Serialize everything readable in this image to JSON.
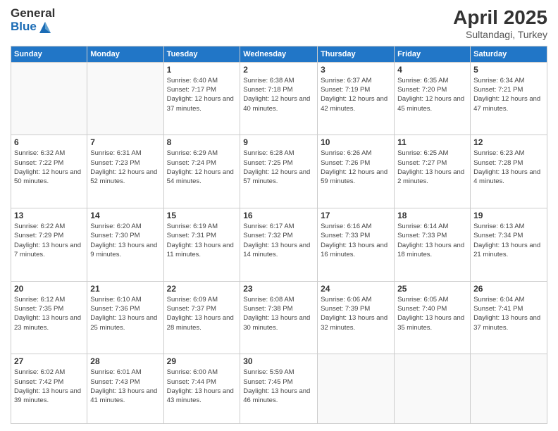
{
  "logo": {
    "general": "General",
    "blue": "Blue"
  },
  "title": "April 2025",
  "location": "Sultandagi, Turkey",
  "days_of_week": [
    "Sunday",
    "Monday",
    "Tuesday",
    "Wednesday",
    "Thursday",
    "Friday",
    "Saturday"
  ],
  "weeks": [
    [
      {
        "day": "",
        "info": ""
      },
      {
        "day": "",
        "info": ""
      },
      {
        "day": "1",
        "info": "Sunrise: 6:40 AM\nSunset: 7:17 PM\nDaylight: 12 hours and 37 minutes."
      },
      {
        "day": "2",
        "info": "Sunrise: 6:38 AM\nSunset: 7:18 PM\nDaylight: 12 hours and 40 minutes."
      },
      {
        "day": "3",
        "info": "Sunrise: 6:37 AM\nSunset: 7:19 PM\nDaylight: 12 hours and 42 minutes."
      },
      {
        "day": "4",
        "info": "Sunrise: 6:35 AM\nSunset: 7:20 PM\nDaylight: 12 hours and 45 minutes."
      },
      {
        "day": "5",
        "info": "Sunrise: 6:34 AM\nSunset: 7:21 PM\nDaylight: 12 hours and 47 minutes."
      }
    ],
    [
      {
        "day": "6",
        "info": "Sunrise: 6:32 AM\nSunset: 7:22 PM\nDaylight: 12 hours and 50 minutes."
      },
      {
        "day": "7",
        "info": "Sunrise: 6:31 AM\nSunset: 7:23 PM\nDaylight: 12 hours and 52 minutes."
      },
      {
        "day": "8",
        "info": "Sunrise: 6:29 AM\nSunset: 7:24 PM\nDaylight: 12 hours and 54 minutes."
      },
      {
        "day": "9",
        "info": "Sunrise: 6:28 AM\nSunset: 7:25 PM\nDaylight: 12 hours and 57 minutes."
      },
      {
        "day": "10",
        "info": "Sunrise: 6:26 AM\nSunset: 7:26 PM\nDaylight: 12 hours and 59 minutes."
      },
      {
        "day": "11",
        "info": "Sunrise: 6:25 AM\nSunset: 7:27 PM\nDaylight: 13 hours and 2 minutes."
      },
      {
        "day": "12",
        "info": "Sunrise: 6:23 AM\nSunset: 7:28 PM\nDaylight: 13 hours and 4 minutes."
      }
    ],
    [
      {
        "day": "13",
        "info": "Sunrise: 6:22 AM\nSunset: 7:29 PM\nDaylight: 13 hours and 7 minutes."
      },
      {
        "day": "14",
        "info": "Sunrise: 6:20 AM\nSunset: 7:30 PM\nDaylight: 13 hours and 9 minutes."
      },
      {
        "day": "15",
        "info": "Sunrise: 6:19 AM\nSunset: 7:31 PM\nDaylight: 13 hours and 11 minutes."
      },
      {
        "day": "16",
        "info": "Sunrise: 6:17 AM\nSunset: 7:32 PM\nDaylight: 13 hours and 14 minutes."
      },
      {
        "day": "17",
        "info": "Sunrise: 6:16 AM\nSunset: 7:33 PM\nDaylight: 13 hours and 16 minutes."
      },
      {
        "day": "18",
        "info": "Sunrise: 6:14 AM\nSunset: 7:33 PM\nDaylight: 13 hours and 18 minutes."
      },
      {
        "day": "19",
        "info": "Sunrise: 6:13 AM\nSunset: 7:34 PM\nDaylight: 13 hours and 21 minutes."
      }
    ],
    [
      {
        "day": "20",
        "info": "Sunrise: 6:12 AM\nSunset: 7:35 PM\nDaylight: 13 hours and 23 minutes."
      },
      {
        "day": "21",
        "info": "Sunrise: 6:10 AM\nSunset: 7:36 PM\nDaylight: 13 hours and 25 minutes."
      },
      {
        "day": "22",
        "info": "Sunrise: 6:09 AM\nSunset: 7:37 PM\nDaylight: 13 hours and 28 minutes."
      },
      {
        "day": "23",
        "info": "Sunrise: 6:08 AM\nSunset: 7:38 PM\nDaylight: 13 hours and 30 minutes."
      },
      {
        "day": "24",
        "info": "Sunrise: 6:06 AM\nSunset: 7:39 PM\nDaylight: 13 hours and 32 minutes."
      },
      {
        "day": "25",
        "info": "Sunrise: 6:05 AM\nSunset: 7:40 PM\nDaylight: 13 hours and 35 minutes."
      },
      {
        "day": "26",
        "info": "Sunrise: 6:04 AM\nSunset: 7:41 PM\nDaylight: 13 hours and 37 minutes."
      }
    ],
    [
      {
        "day": "27",
        "info": "Sunrise: 6:02 AM\nSunset: 7:42 PM\nDaylight: 13 hours and 39 minutes."
      },
      {
        "day": "28",
        "info": "Sunrise: 6:01 AM\nSunset: 7:43 PM\nDaylight: 13 hours and 41 minutes."
      },
      {
        "day": "29",
        "info": "Sunrise: 6:00 AM\nSunset: 7:44 PM\nDaylight: 13 hours and 43 minutes."
      },
      {
        "day": "30",
        "info": "Sunrise: 5:59 AM\nSunset: 7:45 PM\nDaylight: 13 hours and 46 minutes."
      },
      {
        "day": "",
        "info": ""
      },
      {
        "day": "",
        "info": ""
      },
      {
        "day": "",
        "info": ""
      }
    ]
  ]
}
